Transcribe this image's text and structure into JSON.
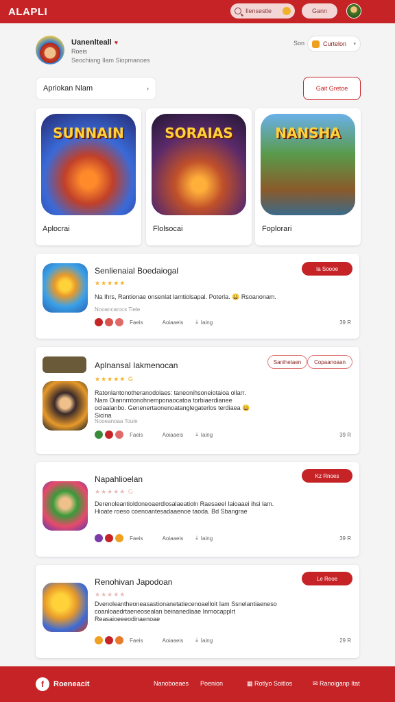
{
  "header": {
    "logo": "ALAPLI",
    "search_text": "Ilensestle",
    "button_label": "Gann"
  },
  "profile": {
    "name": "Uanenlteall",
    "sub1": "Roeis",
    "sub2": "Seochiang Ilam Siopmanoes",
    "son_label": "Son",
    "dropdown_value": "Curtelon"
  },
  "filters": {
    "input_value": "Apriokan Nlam",
    "button_label": "Gait Gretoe"
  },
  "featured": [
    {
      "art_title": "SUNNAIN",
      "label": "Aplocrai"
    },
    {
      "art_title": "SORAIAS",
      "label": "Flolsocai"
    },
    {
      "art_title": "NANSHA",
      "label": "Foplorari"
    }
  ],
  "apps": [
    {
      "title": "Senlienaial Boedaiogal",
      "stars": "★★★★★",
      "desc": "Na Ihrs, Rantionae onsenlat lamtiolsapal. Poterla. 😀 Rsoanonam.",
      "meta": "Nooancarocs Tiele",
      "foot_1": "Faeis",
      "foot_2": "Aoiaaeis",
      "foot_3": "Iaing",
      "num": "39 R",
      "action": "Ia Soooe"
    },
    {
      "title": "Aplnansal Iakmenocan",
      "stars": "★★★★★ G",
      "desc": "Ratonlantonotheranodolaes: taneonihsoneiotaioa ollarr. Nam Oiannrntonohnemponaocatoa torbiaerdianee ociaalanbo. Genenertaonenoatanglegaterlos terdiaea 😀 Sicina",
      "meta": "Nooeanoaa Toule",
      "foot_1": "Faeis",
      "foot_2": "Aoiaaeis",
      "foot_3": "Iaing",
      "num": "39 R",
      "action": "Sanihetaen",
      "action2": "Copaanoaan"
    },
    {
      "title": "Napahlioelan",
      "stars": "★★★★★ G",
      "desc": "Derenoleantioldoneoaerdlosalaeatioln Raesaeel Iaioaaei ihsi lam. Hioate roeso coenoantesadaaenoe taoda. Bd Sbangrae",
      "meta": "",
      "foot_1": "Faeis",
      "foot_2": "Aoiaaeis",
      "foot_3": "Iaing",
      "num": "39 R",
      "action": "Kz Rnoes"
    },
    {
      "title": "Renohivan Japodoan",
      "stars": "★★★★★",
      "desc": "Dvenoleantheoneasastionanetatiecenoaelloit Iam Ssnelantiaeneso coanloaedrtaeneosealan beinanedlaae Inrnocapplrt Reasaioeeeodinaenoae",
      "meta": "",
      "foot_1": "Faeis",
      "foot_2": "Aoiaaeis",
      "foot_3": "Iaing",
      "num": "29 R",
      "action": "Le Reoe"
    }
  ],
  "footer": {
    "brand": "Roeneacit",
    "links": [
      "Nanoboeaes",
      "Poenion",
      "Rotlyo Soitlos",
      "Ranoiganp Itat"
    ]
  },
  "colors": {
    "accent": "#c62326",
    "star": "#f2b01e"
  }
}
